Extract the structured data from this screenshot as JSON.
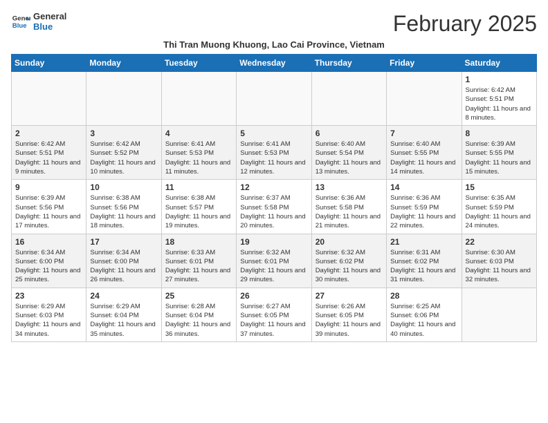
{
  "header": {
    "logo_general": "General",
    "logo_blue": "Blue",
    "month_year": "February 2025",
    "location": "Thi Tran Muong Khuong, Lao Cai Province, Vietnam"
  },
  "weekdays": [
    "Sunday",
    "Monday",
    "Tuesday",
    "Wednesday",
    "Thursday",
    "Friday",
    "Saturday"
  ],
  "weeks": [
    [
      {
        "day": "",
        "info": ""
      },
      {
        "day": "",
        "info": ""
      },
      {
        "day": "",
        "info": ""
      },
      {
        "day": "",
        "info": ""
      },
      {
        "day": "",
        "info": ""
      },
      {
        "day": "",
        "info": ""
      },
      {
        "day": "1",
        "info": "Sunrise: 6:42 AM\nSunset: 5:51 PM\nDaylight: 11 hours and 8 minutes."
      }
    ],
    [
      {
        "day": "2",
        "info": "Sunrise: 6:42 AM\nSunset: 5:51 PM\nDaylight: 11 hours and 9 minutes."
      },
      {
        "day": "3",
        "info": "Sunrise: 6:42 AM\nSunset: 5:52 PM\nDaylight: 11 hours and 10 minutes."
      },
      {
        "day": "4",
        "info": "Sunrise: 6:41 AM\nSunset: 5:53 PM\nDaylight: 11 hours and 11 minutes."
      },
      {
        "day": "5",
        "info": "Sunrise: 6:41 AM\nSunset: 5:53 PM\nDaylight: 11 hours and 12 minutes."
      },
      {
        "day": "6",
        "info": "Sunrise: 6:40 AM\nSunset: 5:54 PM\nDaylight: 11 hours and 13 minutes."
      },
      {
        "day": "7",
        "info": "Sunrise: 6:40 AM\nSunset: 5:55 PM\nDaylight: 11 hours and 14 minutes."
      },
      {
        "day": "8",
        "info": "Sunrise: 6:39 AM\nSunset: 5:55 PM\nDaylight: 11 hours and 15 minutes."
      }
    ],
    [
      {
        "day": "9",
        "info": "Sunrise: 6:39 AM\nSunset: 5:56 PM\nDaylight: 11 hours and 17 minutes."
      },
      {
        "day": "10",
        "info": "Sunrise: 6:38 AM\nSunset: 5:56 PM\nDaylight: 11 hours and 18 minutes."
      },
      {
        "day": "11",
        "info": "Sunrise: 6:38 AM\nSunset: 5:57 PM\nDaylight: 11 hours and 19 minutes."
      },
      {
        "day": "12",
        "info": "Sunrise: 6:37 AM\nSunset: 5:58 PM\nDaylight: 11 hours and 20 minutes."
      },
      {
        "day": "13",
        "info": "Sunrise: 6:36 AM\nSunset: 5:58 PM\nDaylight: 11 hours and 21 minutes."
      },
      {
        "day": "14",
        "info": "Sunrise: 6:36 AM\nSunset: 5:59 PM\nDaylight: 11 hours and 22 minutes."
      },
      {
        "day": "15",
        "info": "Sunrise: 6:35 AM\nSunset: 5:59 PM\nDaylight: 11 hours and 24 minutes."
      }
    ],
    [
      {
        "day": "16",
        "info": "Sunrise: 6:34 AM\nSunset: 6:00 PM\nDaylight: 11 hours and 25 minutes."
      },
      {
        "day": "17",
        "info": "Sunrise: 6:34 AM\nSunset: 6:00 PM\nDaylight: 11 hours and 26 minutes."
      },
      {
        "day": "18",
        "info": "Sunrise: 6:33 AM\nSunset: 6:01 PM\nDaylight: 11 hours and 27 minutes."
      },
      {
        "day": "19",
        "info": "Sunrise: 6:32 AM\nSunset: 6:01 PM\nDaylight: 11 hours and 29 minutes."
      },
      {
        "day": "20",
        "info": "Sunrise: 6:32 AM\nSunset: 6:02 PM\nDaylight: 11 hours and 30 minutes."
      },
      {
        "day": "21",
        "info": "Sunrise: 6:31 AM\nSunset: 6:02 PM\nDaylight: 11 hours and 31 minutes."
      },
      {
        "day": "22",
        "info": "Sunrise: 6:30 AM\nSunset: 6:03 PM\nDaylight: 11 hours and 32 minutes."
      }
    ],
    [
      {
        "day": "23",
        "info": "Sunrise: 6:29 AM\nSunset: 6:03 PM\nDaylight: 11 hours and 34 minutes."
      },
      {
        "day": "24",
        "info": "Sunrise: 6:29 AM\nSunset: 6:04 PM\nDaylight: 11 hours and 35 minutes."
      },
      {
        "day": "25",
        "info": "Sunrise: 6:28 AM\nSunset: 6:04 PM\nDaylight: 11 hours and 36 minutes."
      },
      {
        "day": "26",
        "info": "Sunrise: 6:27 AM\nSunset: 6:05 PM\nDaylight: 11 hours and 37 minutes."
      },
      {
        "day": "27",
        "info": "Sunrise: 6:26 AM\nSunset: 6:05 PM\nDaylight: 11 hours and 39 minutes."
      },
      {
        "day": "28",
        "info": "Sunrise: 6:25 AM\nSunset: 6:06 PM\nDaylight: 11 hours and 40 minutes."
      },
      {
        "day": "",
        "info": ""
      }
    ]
  ]
}
